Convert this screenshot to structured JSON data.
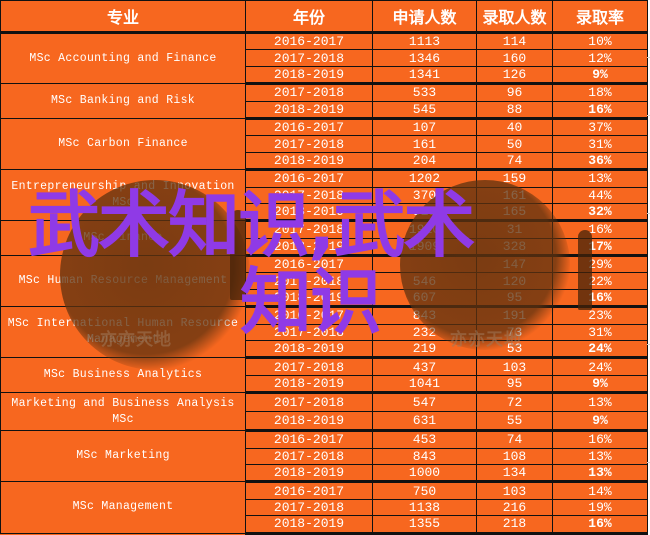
{
  "table": {
    "headers": [
      "专业",
      "年份",
      "申请人数",
      "录取人数",
      "录取率"
    ],
    "groups": [
      {
        "major": "MSc Accounting  and Finance",
        "rows": [
          {
            "year": "2016-2017",
            "applicants": "1113",
            "admitted": "114",
            "rate": "10%"
          },
          {
            "year": "2017-2018",
            "applicants": "1346",
            "admitted": "160",
            "rate": "12%"
          },
          {
            "year": "2018-2019",
            "applicants": "1341",
            "admitted": "126",
            "rate": "9%"
          }
        ]
      },
      {
        "major": "MSc Banking  and Risk",
        "rows": [
          {
            "year": "2017-2018",
            "applicants": "533",
            "admitted": "96",
            "rate": "18%"
          },
          {
            "year": "2018-2019",
            "applicants": "545",
            "admitted": "88",
            "rate": "16%"
          }
        ]
      },
      {
        "major": "MSc Carbon Finance",
        "rows": [
          {
            "year": "2016-2017",
            "applicants": "107",
            "admitted": "40",
            "rate": "37%"
          },
          {
            "year": "2017-2018",
            "applicants": "161",
            "admitted": "50",
            "rate": "31%"
          },
          {
            "year": "2018-2019",
            "applicants": "204",
            "admitted": "74",
            "rate": "36%"
          }
        ]
      },
      {
        "major": "Entrepreneurship and Innovation MSc",
        "rows": [
          {
            "year": "2016-2017",
            "applicants": "1202",
            "admitted": "159",
            "rate": "13%"
          },
          {
            "year": "2017-2018",
            "applicants": "370",
            "admitted": "161",
            "rate": "44%"
          },
          {
            "year": "2018-2019",
            "applicants": "515",
            "admitted": "165",
            "rate": "32%"
          }
        ]
      },
      {
        "major": "MSc Finance",
        "rows": [
          {
            "year": "2017-2018",
            "applicants": "1910",
            "admitted": "31",
            "rate": "16%"
          },
          {
            "year": "2018-2019",
            "applicants": "1909",
            "admitted": "328",
            "rate": "17%"
          }
        ]
      },
      {
        "major": "MSc Human Resource Management",
        "rows": [
          {
            "year": "2016-2017",
            "applicants": "",
            "admitted": "147",
            "rate": "29%"
          },
          {
            "year": "2017-2018",
            "applicants": "546",
            "admitted": "120",
            "rate": "22%"
          },
          {
            "year": "2018-2019",
            "applicants": "607",
            "admitted": "95",
            "rate": "16%"
          }
        ]
      },
      {
        "major": "MSc International Human Resource Management",
        "rows": [
          {
            "year": "2016-2017",
            "applicants": "843",
            "admitted": "191",
            "rate": "23%"
          },
          {
            "year": "2017-2018",
            "applicants": "232",
            "admitted": "73",
            "rate": "31%"
          },
          {
            "year": "2018-2019",
            "applicants": "219",
            "admitted": "53",
            "rate": "24%"
          }
        ]
      },
      {
        "major": "MSc  Business Analytics",
        "rows": [
          {
            "year": "2017-2018",
            "applicants": "437",
            "admitted": "103",
            "rate": "24%"
          },
          {
            "year": "2018-2019",
            "applicants": "1041",
            "admitted": "95",
            "rate": "9%"
          }
        ]
      },
      {
        "major": "Marketing and Business Analysis MSc",
        "rows": [
          {
            "year": "2017-2018",
            "applicants": "547",
            "admitted": "72",
            "rate": "13%"
          },
          {
            "year": "2018-2019",
            "applicants": "631",
            "admitted": "55",
            "rate": "9%"
          }
        ]
      },
      {
        "major": "MSc Marketing",
        "rows": [
          {
            "year": "2016-2017",
            "applicants": "453",
            "admitted": "74",
            "rate": "16%"
          },
          {
            "year": "2017-2018",
            "applicants": "843",
            "admitted": "108",
            "rate": "13%"
          },
          {
            "year": "2018-2019",
            "applicants": "1000",
            "admitted": "134",
            "rate": "13%"
          }
        ]
      },
      {
        "major": "MSc Management",
        "rows": [
          {
            "year": "2016-2017",
            "applicants": "750",
            "admitted": "103",
            "rate": "14%"
          },
          {
            "year": "2017-2018",
            "applicants": "1138",
            "admitted": "216",
            "rate": "19%"
          },
          {
            "year": "2018-2019",
            "applicants": "1355",
            "admitted": "218",
            "rate": "16%"
          }
        ]
      }
    ]
  },
  "watermark": {
    "line1": "武术知识,武术",
    "line2": "知识",
    "brand": "亦亦天地"
  },
  "colors": {
    "cell_fill": "#f7671f",
    "watermark_text": "#8f3ae6"
  }
}
